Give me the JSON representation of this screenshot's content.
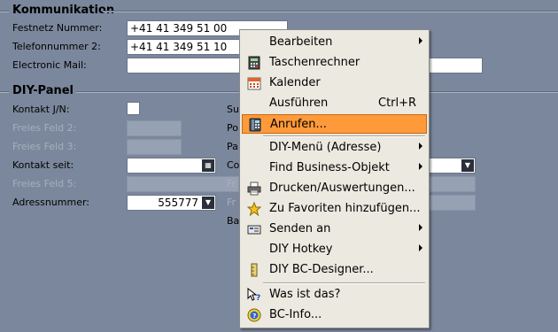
{
  "kommunikation": {
    "title": "Kommunikation",
    "festnetz_label": "Festnetz Nummer:",
    "festnetz_value": "+41 41 349 51 00",
    "telefon_label": "Telefonnummer 2:",
    "telefon_value": "+41 41 349 51 10",
    "email_label": "Electronic Mail:",
    "email_value": ""
  },
  "diy": {
    "title": "DIY-Panel",
    "kontakt_jn_label": "Kontakt J/N:",
    "freies2_label": "Freies Feld 2:",
    "freies3_label": "Freies Feld 3:",
    "kontakt_seit_label": "Kontakt seit:",
    "freies5_label": "Freies Feld 5:",
    "adressnummer_label": "Adressnummer:",
    "adressnummer_value": "555777",
    "right_labels": [
      "Su",
      "Po",
      "Pa",
      "Co",
      "Fr",
      "Fr",
      "Ba"
    ]
  },
  "menu": {
    "items": [
      {
        "label": "Bearbeiten",
        "shortcut": "",
        "icon": "none",
        "submenu": true
      },
      {
        "label": "Taschenrechner",
        "shortcut": "",
        "icon": "calculator-icon",
        "submenu": false
      },
      {
        "label": "Kalender",
        "shortcut": "",
        "icon": "calendar-icon",
        "submenu": false
      },
      {
        "label": "Ausführen",
        "shortcut": "Ctrl+R",
        "icon": "none",
        "submenu": false
      },
      {
        "label": "Anrufen...",
        "shortcut": "",
        "icon": "phone-icon",
        "submenu": false,
        "highlighted": true
      },
      {
        "label": "DIY-Menü (Adresse)",
        "shortcut": "",
        "icon": "none",
        "submenu": true
      },
      {
        "label": "Find Business-Objekt",
        "shortcut": "",
        "icon": "none",
        "submenu": true
      },
      {
        "label": "Drucken/Auswertungen...",
        "shortcut": "",
        "icon": "printer-icon",
        "submenu": false
      },
      {
        "label": "Zu Favoriten hinzufügen...",
        "shortcut": "",
        "icon": "star-icon",
        "submenu": false
      },
      {
        "label": "Senden an",
        "shortcut": "",
        "icon": "send-icon",
        "submenu": true
      },
      {
        "label": "DIY Hotkey",
        "shortcut": "",
        "icon": "none",
        "submenu": true
      },
      {
        "label": "DIY BC-Designer...",
        "shortcut": "",
        "icon": "designer-icon",
        "submenu": false
      },
      {
        "label": "Was ist das?",
        "shortcut": "",
        "icon": "help-pointer-icon",
        "submenu": false
      },
      {
        "label": "BC-Info...",
        "shortcut": "",
        "icon": "info-icon",
        "submenu": false
      }
    ],
    "highlight_color": "#fe9a3a"
  }
}
